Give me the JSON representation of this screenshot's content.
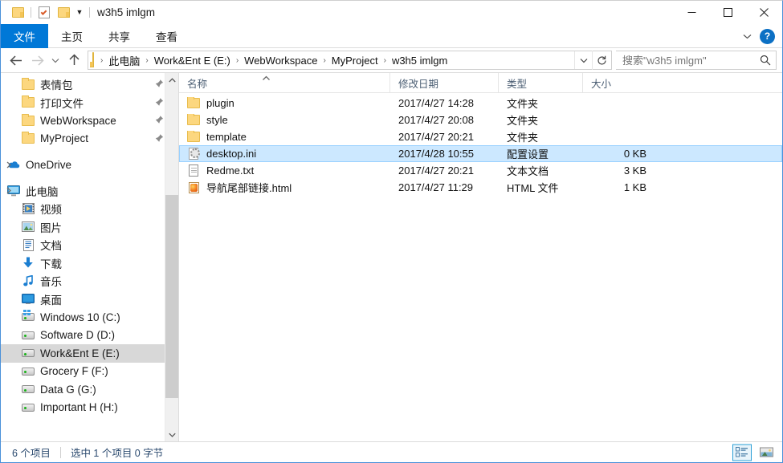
{
  "window": {
    "title": "w3h5 imlgm",
    "quick_access": [
      "folder-icon",
      "properties-icon",
      "new-folder-icon",
      "customize-chevron-icon"
    ],
    "controls": {
      "minimize": "minimize-icon",
      "maximize": "maximize-icon",
      "close": "close-icon"
    }
  },
  "ribbon": {
    "tabs": [
      {
        "label": "文件",
        "active": true
      },
      {
        "label": "主页",
        "active": false
      },
      {
        "label": "共享",
        "active": false
      },
      {
        "label": "查看",
        "active": false
      }
    ],
    "collapse_icon": "chevron-down-icon",
    "help_label": "?"
  },
  "address": {
    "back_icon": "back-arrow-icon",
    "forward_icon": "forward-arrow-icon",
    "recent_icon": "chevron-down-icon",
    "up_icon": "up-arrow-icon",
    "breadcrumbs": [
      "此电脑",
      "Work&Ent E (E:)",
      "WebWorkspace",
      "MyProject",
      "w3h5 imlgm"
    ],
    "separator": "›",
    "dropdown_icon": "chevron-down-icon",
    "refresh_icon": "refresh-icon"
  },
  "search": {
    "placeholder": "搜索\"w3h5 imlgm\"",
    "value": "",
    "icon": "search-icon"
  },
  "navpane": {
    "items": [
      {
        "label": "表情包",
        "icon": "folder-icon",
        "indent": 1,
        "pinned": true,
        "selected": false
      },
      {
        "label": "打印文件",
        "icon": "folder-icon",
        "indent": 1,
        "pinned": true,
        "selected": false
      },
      {
        "label": "WebWorkspace",
        "icon": "folder-icon",
        "indent": 1,
        "pinned": true,
        "selected": false
      },
      {
        "label": "MyProject",
        "icon": "folder-icon",
        "indent": 1,
        "pinned": true,
        "selected": false
      },
      {
        "label": "",
        "icon": "spacer",
        "indent": 0,
        "pinned": false,
        "selected": false,
        "spacer": true
      },
      {
        "label": "OneDrive",
        "icon": "onedrive-icon",
        "indent": 0,
        "pinned": false,
        "selected": false,
        "expander": true
      },
      {
        "label": "",
        "icon": "spacer",
        "indent": 0,
        "pinned": false,
        "selected": false,
        "spacer": true
      },
      {
        "label": "此电脑",
        "icon": "computer-icon",
        "indent": 0,
        "pinned": false,
        "selected": false,
        "expander": true
      },
      {
        "label": "视频",
        "icon": "videos-icon",
        "indent": 1,
        "pinned": false,
        "selected": false
      },
      {
        "label": "图片",
        "icon": "pictures-icon",
        "indent": 1,
        "pinned": false,
        "selected": false
      },
      {
        "label": "文档",
        "icon": "documents-icon",
        "indent": 1,
        "pinned": false,
        "selected": false
      },
      {
        "label": "下载",
        "icon": "downloads-icon",
        "indent": 1,
        "pinned": false,
        "selected": false
      },
      {
        "label": "音乐",
        "icon": "music-icon",
        "indent": 1,
        "pinned": false,
        "selected": false
      },
      {
        "label": "桌面",
        "icon": "desktop-icon",
        "indent": 1,
        "pinned": false,
        "selected": false
      },
      {
        "label": "Windows 10 (C:)",
        "icon": "system-drive-icon",
        "indent": 1,
        "pinned": false,
        "selected": false
      },
      {
        "label": "Software D (D:)",
        "icon": "drive-icon",
        "indent": 1,
        "pinned": false,
        "selected": false
      },
      {
        "label": "Work&Ent E (E:)",
        "icon": "drive-icon",
        "indent": 1,
        "pinned": false,
        "selected": true
      },
      {
        "label": "Grocery F (F:)",
        "icon": "drive-icon",
        "indent": 1,
        "pinned": false,
        "selected": false
      },
      {
        "label": "Data G (G:)",
        "icon": "drive-icon",
        "indent": 1,
        "pinned": false,
        "selected": false
      },
      {
        "label": "Important H (H:)",
        "icon": "drive-icon",
        "indent": 1,
        "pinned": false,
        "selected": false
      }
    ],
    "scroll": {
      "up_icon": "chevron-up-icon",
      "down_icon": "chevron-down-icon"
    }
  },
  "filelist": {
    "columns": [
      {
        "label": "名称",
        "key": "name",
        "sorted": "asc"
      },
      {
        "label": "修改日期",
        "key": "date",
        "sorted": null
      },
      {
        "label": "类型",
        "key": "type",
        "sorted": null
      },
      {
        "label": "大小",
        "key": "size",
        "sorted": null
      }
    ],
    "sort_icon": "chevron-up-icon",
    "rows": [
      {
        "name": "plugin",
        "date": "2017/4/27 14:28",
        "type": "文件夹",
        "size": "",
        "icon": "folder-icon",
        "selected": false
      },
      {
        "name": "style",
        "date": "2017/4/27 20:08",
        "type": "文件夹",
        "size": "",
        "icon": "folder-icon",
        "selected": false
      },
      {
        "name": "template",
        "date": "2017/4/27 20:21",
        "type": "文件夹",
        "size": "",
        "icon": "folder-icon",
        "selected": false
      },
      {
        "name": "desktop.ini",
        "date": "2017/4/28 10:55",
        "type": "配置设置",
        "size": "0 KB",
        "icon": "ini-file-icon",
        "selected": true
      },
      {
        "name": "Redme.txt",
        "date": "2017/4/27 20:21",
        "type": "文本文档",
        "size": "3 KB",
        "icon": "text-file-icon",
        "selected": false
      },
      {
        "name": "导航尾部链接.html",
        "date": "2017/4/27 11:29",
        "type": "HTML 文件",
        "size": "1 KB",
        "icon": "html-file-icon",
        "selected": false
      }
    ]
  },
  "statusbar": {
    "item_count": "6 个项目",
    "selection": "选中 1 个项目  0 字节",
    "view_buttons": [
      {
        "name": "details-view-icon",
        "active": true
      },
      {
        "name": "large-icons-view-icon",
        "active": false
      }
    ]
  },
  "colors": {
    "accent": "#0078d7",
    "selection_fill": "#cce8ff",
    "selection_border": "#99d1ff",
    "nav_selected": "#d8d8d8",
    "folder_yellow": "#fcd77f",
    "status_text": "#2b4a6f",
    "column_header_text": "#4b5e73"
  }
}
